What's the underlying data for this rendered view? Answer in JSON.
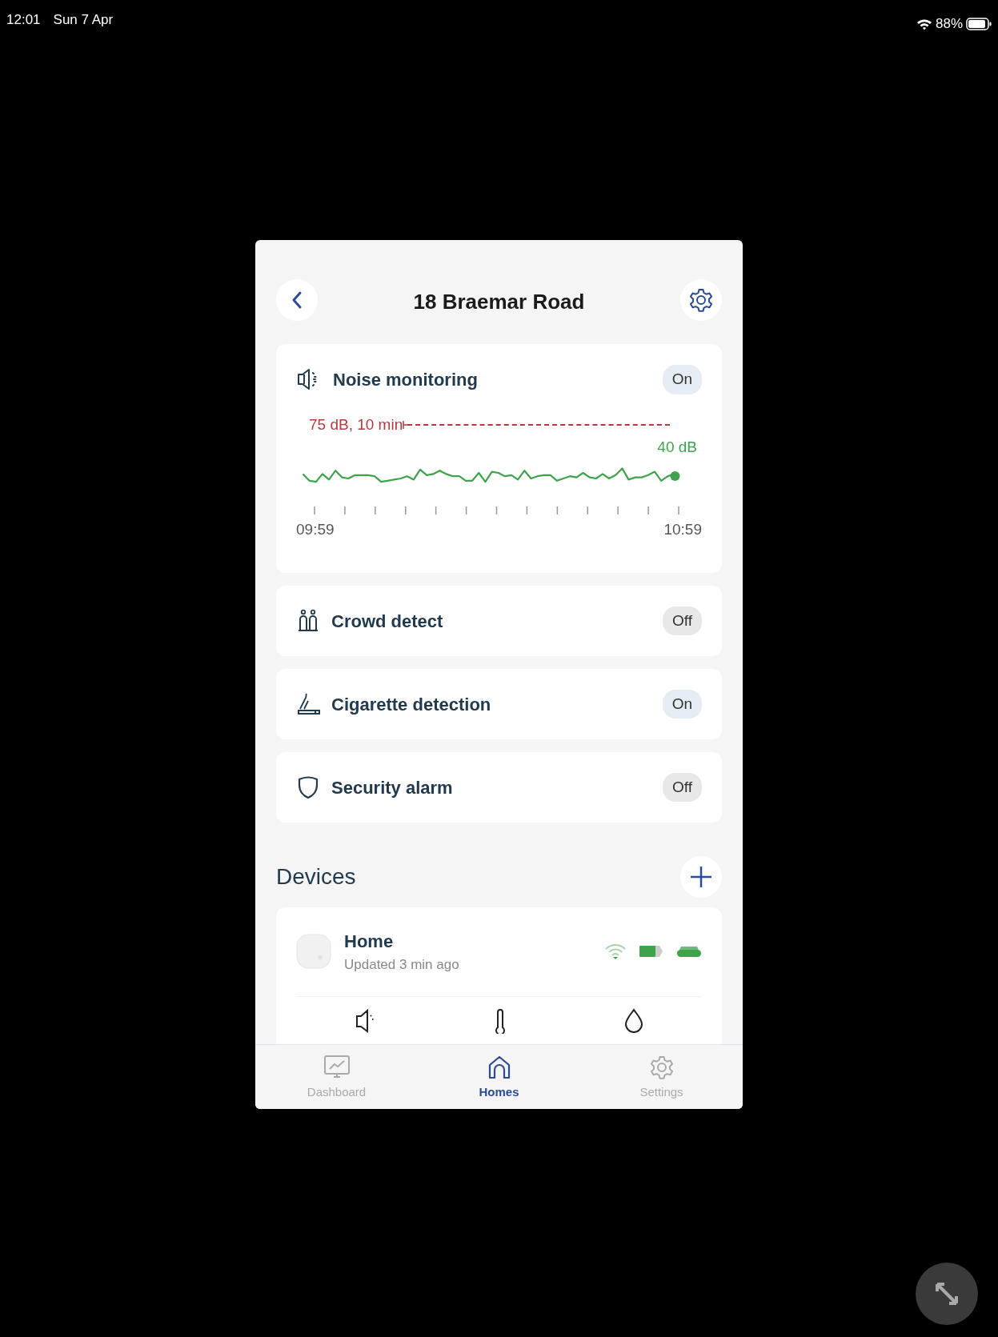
{
  "status_bar": {
    "time": "12:01",
    "date": "Sun 7 Apr",
    "battery": "88%"
  },
  "header": {
    "title": "18 Braemar Road"
  },
  "noise": {
    "label": "Noise monitoring",
    "state": "On",
    "on": true,
    "threshold": "75 dB, 10 min",
    "current": "40 dB",
    "start_time": "09:59",
    "end_time": "10:59"
  },
  "features": [
    {
      "kind": "crowd",
      "label": "Crowd detect",
      "state": "Off",
      "on": false
    },
    {
      "kind": "cigarette",
      "label": "Cigarette detection",
      "state": "On",
      "on": true
    },
    {
      "kind": "shield",
      "label": "Security alarm",
      "state": "Off",
      "on": false
    }
  ],
  "devices": {
    "title": "Devices",
    "items": [
      {
        "name": "Home",
        "updated": "Updated 3 min ago"
      }
    ]
  },
  "tabs": [
    {
      "kind": "dashboard",
      "label": "Dashboard",
      "selected": false
    },
    {
      "kind": "home",
      "label": "Homes",
      "selected": true
    },
    {
      "kind": "settings",
      "label": "Settings",
      "selected": false
    }
  ]
}
